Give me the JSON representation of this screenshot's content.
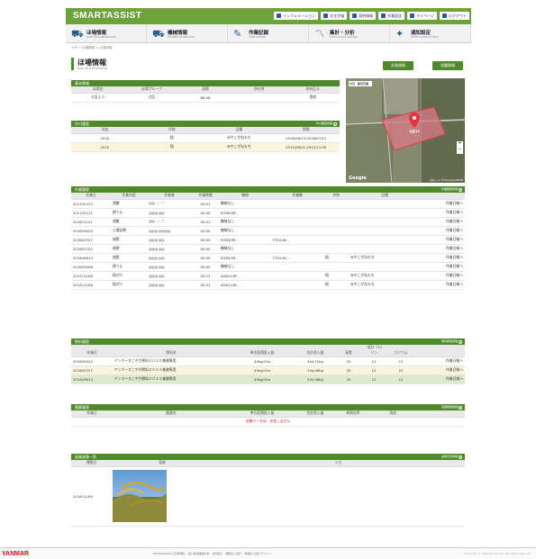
{
  "header": {
    "brand": "SMARTASSIST",
    "links": [
      {
        "label": "インフォメーション",
        "icon": "bell-icon"
      },
      {
        "label": "文言字幅",
        "icon": "textsize-icon"
      },
      {
        "label": "契約情報",
        "icon": "document-icon"
      },
      {
        "label": "作業設定",
        "icon": "gear-icon"
      },
      {
        "label": "マイページ",
        "icon": "user-icon"
      },
      {
        "label": "ログアウト",
        "icon": "logout-icon"
      }
    ]
  },
  "nav": [
    {
      "label": "ほ場情報",
      "sub": "FARM FIELD INFORMATION",
      "icon": "tractor-field-icon"
    },
    {
      "label": "機械情報",
      "sub": "MACHINE INFORMATION",
      "icon": "truck-icon"
    },
    {
      "label": "作業記録",
      "sub": "WORK RECORD",
      "icon": "pen-icon"
    },
    {
      "label": "集計・分析",
      "sub": "TABULATION & ANALYSIS",
      "icon": "chart-icon"
    },
    {
      "label": "通知設定",
      "sub": "NOTIFICATION SETTINGS",
      "icon": "bell-notify-icon"
    }
  ],
  "breadcrumb": "TOP > ほ場情報 > ほ場詳細",
  "page": {
    "title": "ほ場情報",
    "subtitle": "FARM FIELD INFORMATION",
    "btn_weather": "気象情報",
    "btn_growth": "収穫情報"
  },
  "basic": {
    "title": "基本情報",
    "headers": [
      "ほ場名",
      "ほ場グループ",
      "面積",
      "所在地",
      "所有区分"
    ],
    "row": [
      "七区１２",
      "七区",
      "86.06",
      "",
      "賃地"
    ]
  },
  "crop": {
    "title": "作付履歴",
    "button": "作付履歴詳細",
    "headers": [
      "年度",
      "作物",
      "品種",
      "期間"
    ],
    "rows": [
      [
        "2016",
        "稲",
        "みやこがねもち",
        "2016/06/13-2016/07/12"
      ],
      [
        "2015",
        "稲",
        "みやこがねもち",
        "2015/06/01-2015/11/30"
      ]
    ]
  },
  "map": {
    "tab1": "地図",
    "tab2": "航空写真",
    "label": "七区12",
    "provider": "Google",
    "zoom_in": "+",
    "zoom_out": "−",
    "attribution": "地図データ ©2016 Google ZENRIN"
  },
  "work": {
    "title": "作業履歴",
    "button": "作業履歴詳細",
    "headers": [
      "作業日",
      "作業内容",
      "作業者",
      "作業時間",
      "機械",
      "作業機",
      "作物",
      "品種",
      ""
    ],
    "rows": [
      [
        "2017/01/13",
        "運搬",
        "■■ ユーザ",
        "00:01",
        "機械なし",
        "",
        "",
        "",
        "作業日報へ"
      ],
      [
        "2017/01/11",
        "耕うん",
        "■■■ ■■",
        "00:00",
        "EG65/99 -",
        "",
        "",
        "",
        "作業日報へ"
      ],
      [
        "2016/11/21",
        "運搬",
        "■■ ユーザ",
        "00:01",
        "機械なし",
        "",
        "",
        "",
        "作業日報へ"
      ],
      [
        "2016/09/20",
        "土壌診断",
        "■■■ ■■■■",
        "02:00",
        "機械なし",
        "",
        "",
        "",
        "作業日報へ"
      ],
      [
        "2016/07/27",
        "施肥",
        "■■■ ■■",
        "00:00",
        "EG65/99 -",
        "FTV240/ -",
        "",
        "",
        "作業日報へ"
      ],
      [
        "2016/07/22",
        "施肥",
        "■■■ ■■",
        "00:00",
        "機械なし",
        "",
        "",
        "",
        "作業日報へ"
      ],
      [
        "2016/06/14",
        "施肥",
        "■■■ ■■",
        "00:00",
        "EG65/99 -",
        "FTV240/ -",
        "稲",
        "みやこがねもち",
        "作業日報へ"
      ],
      [
        "2016/05/06",
        "耕うん",
        "■■■ ■■",
        "00:00",
        "機械なし",
        "",
        "",
        "",
        "作業日報へ"
      ],
      [
        "2015/11/06",
        "稲刈り",
        "■■■ ■■",
        "00:12",
        "AG6114R -",
        "",
        "稲",
        "みやこがねもち",
        "作業日報へ"
      ],
      [
        "2015/11/06",
        "稲刈り",
        "■■■ ■■",
        "00:21",
        "AG6114R -",
        "",
        "稲",
        "みやこがねもち",
        "作業日報へ"
      ]
    ]
  },
  "fert": {
    "title": "肥料履歴",
    "button": "肥料履歴詳細",
    "headers": [
      "作業日",
      "肥料名",
      "単位面積投入量",
      "合計投入量",
      "窒素",
      "リン",
      "カリウム",
      ""
    ],
    "group_header": "成分（%）",
    "rows": [
      [
        "2016/09/20",
        "ヤンマーすこやか肥料２０２２基礎専用",
        "40kg/10a",
        "344.12kg",
        "20",
        "12",
        "12",
        "作業日報へ"
      ],
      [
        "2016/07/27",
        "ヤンマーすこやか肥料２０２２基礎専用",
        "40kg/10a",
        "344.08kg",
        "20",
        "12",
        "12",
        "作業日報へ"
      ],
      [
        "2016/06/14",
        "ヤンマーすこやか肥料２０２２基礎専用",
        "40kg/10a",
        "344.08kg",
        "20",
        "12",
        "12",
        "作業日報へ"
      ]
    ]
  },
  "pest": {
    "title": "農薬履歴",
    "button": "農薬履歴詳細",
    "headers": [
      "作業日",
      "農薬名",
      "単位面積投入量",
      "合計投入量",
      "希釈倍率",
      "用途",
      ""
    ],
    "empty": "対象データは、存在しません"
  },
  "photo": {
    "title": "画像画像一覧",
    "button": "画像写真詳細",
    "headers": [
      "撮影日",
      "画像",
      "メモ"
    ],
    "date": "2016/11/09"
  },
  "footer": {
    "logo": "YANMAR",
    "links": [
      "SMARTASSISTご利用規約",
      "個人情報保護方針",
      "お問合せ",
      "機能のご紹介",
      "機械のご紹介サイトへ"
    ],
    "copyright": "Copyright © YANMAR CO.,LTD. All rights reserved."
  },
  "colors": {
    "brand_green": "#6ea33c",
    "section_green": "#4e8a2a",
    "highlight_yellow": "#fbf4dc",
    "highlight_green": "#dfeacb",
    "logo_red": "#d0101a"
  }
}
